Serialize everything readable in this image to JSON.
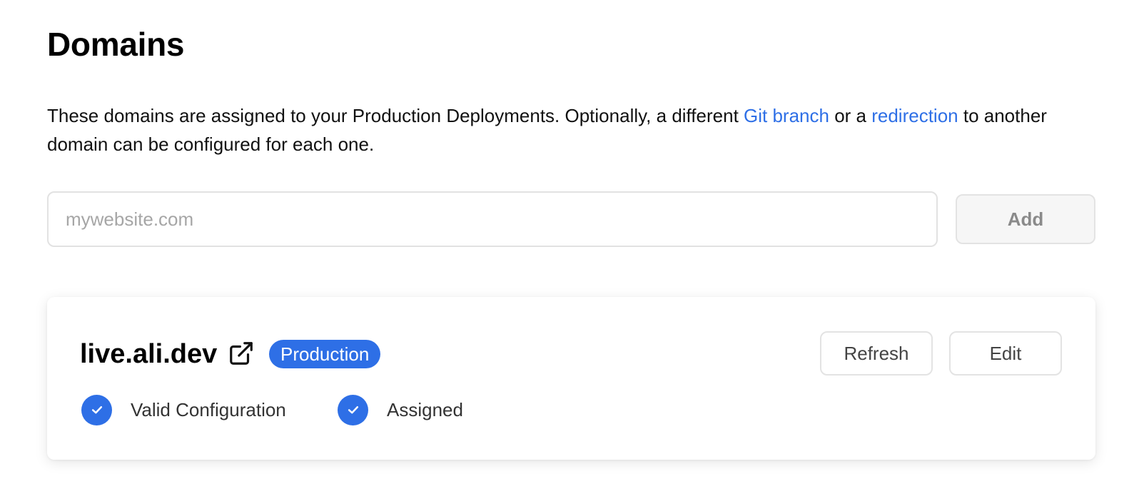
{
  "page": {
    "title": "Domains",
    "description": {
      "text_before": "These domains are assigned to your Production Deployments. Optionally, a different ",
      "git_branch_link": "Git branch",
      "text_middle": " or a ",
      "redirection_link": "redirection",
      "text_after": " to another domain can be configured for each one."
    }
  },
  "add_domain": {
    "placeholder": "mywebsite.com",
    "value": "",
    "button_label": "Add"
  },
  "domain_card": {
    "domain": "live.ali.dev",
    "badge": "Production",
    "refresh_label": "Refresh",
    "edit_label": "Edit",
    "statuses": [
      {
        "label": "Valid Configuration",
        "icon": "check-circle-icon"
      },
      {
        "label": "Assigned",
        "icon": "check-circle-icon"
      }
    ]
  },
  "colors": {
    "accent": "#2e6fe6",
    "text": "#111111",
    "muted": "#8a8a8a"
  }
}
